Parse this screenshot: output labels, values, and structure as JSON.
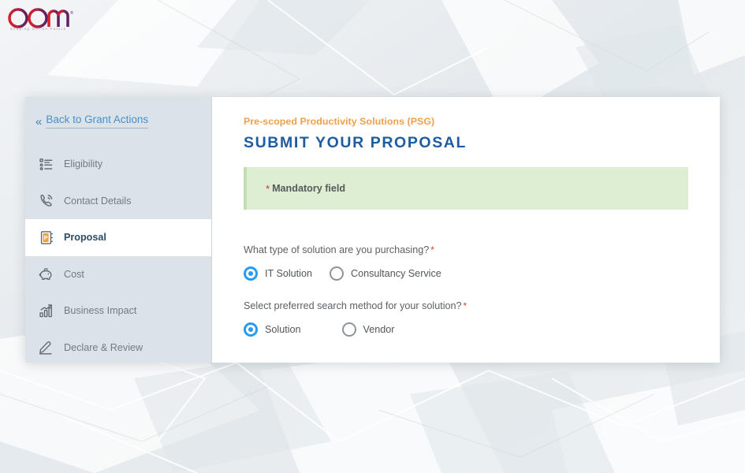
{
  "brand": {
    "logo_text": "OOm",
    "logo_trademark": "®",
    "tagline": "Shaping Online Future"
  },
  "colors": {
    "accent_orange": "#f0a04b",
    "title_blue": "#1f5c9e",
    "link_blue": "#4a8ecb",
    "radio_blue": "#2a9bee",
    "banner_green": "#ddeed2",
    "banner_green_border": "#c3dfb0",
    "required_red": "#d0342c",
    "sidebar_bg": "#dbe3e9"
  },
  "sidebar": {
    "back_link": {
      "label": "Back to Grant Actions",
      "chevron": "«"
    },
    "items": [
      {
        "label": "Eligibility",
        "icon": "checklist-icon",
        "active": false
      },
      {
        "label": "Contact Details",
        "icon": "phone-icon",
        "active": false
      },
      {
        "label": "Proposal",
        "icon": "notebook-icon",
        "active": true
      },
      {
        "label": "Cost",
        "icon": "piggy-bank-icon",
        "active": false
      },
      {
        "label": "Business Impact",
        "icon": "bar-chart-icon",
        "active": false
      },
      {
        "label": "Declare & Review",
        "icon": "pen-icon",
        "active": false
      }
    ]
  },
  "content": {
    "eyebrow": "Pre-scoped Productivity Solutions (PSG)",
    "title": "SUBMIT YOUR PROPOSAL",
    "banner": {
      "star": "*",
      "text": "Mandatory field"
    },
    "fields": [
      {
        "label": "What type of solution are you purchasing?",
        "required_star": "*",
        "options": [
          {
            "label": "IT Solution",
            "selected": true
          },
          {
            "label": "Consultancy Service",
            "selected": false
          }
        ]
      },
      {
        "label": "Select preferred search method for your solution?",
        "required_star": "*",
        "options": [
          {
            "label": "Solution",
            "selected": true
          },
          {
            "label": "Vendor",
            "selected": false
          }
        ]
      }
    ]
  }
}
